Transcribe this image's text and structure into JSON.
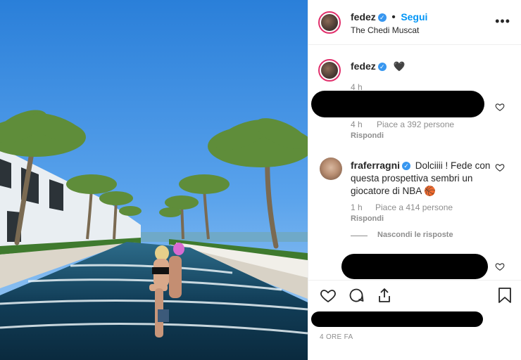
{
  "post": {
    "author": "fedez",
    "follow_label": "Segui",
    "location": "The Chedi Muscat",
    "more_label": "•••",
    "verified_mark": "✓"
  },
  "caption": {
    "author": "fedez",
    "text": "🖤",
    "age": "4 h"
  },
  "comments": [
    {
      "author": "",
      "text": "",
      "age": "4 h",
      "likes": "Piace a 392 persone",
      "reply": "Rispondi",
      "redacted": true
    },
    {
      "author": "fraferragni",
      "text_line1": "Dolciiii ! Fede con",
      "text_line2": "questa prospettiva sembri un",
      "text_line3": "giocatore di NBA 🏀",
      "age": "1 h",
      "likes": "Piace a 414 persone",
      "reply": "Rispondi",
      "hide_replies": "Nascondi le risposte"
    },
    {
      "author": "",
      "text": "",
      "redacted": true
    }
  ],
  "footer": {
    "timestamp": "4 ORE FA"
  },
  "icons": {
    "like": "heart-icon",
    "comment": "comment-icon",
    "share": "share-icon",
    "save": "bookmark-icon",
    "options": "ellipsis-icon"
  },
  "colors": {
    "accent": "#0095f6",
    "verified": "#3897f0",
    "story_ring": "#e1306c"
  }
}
